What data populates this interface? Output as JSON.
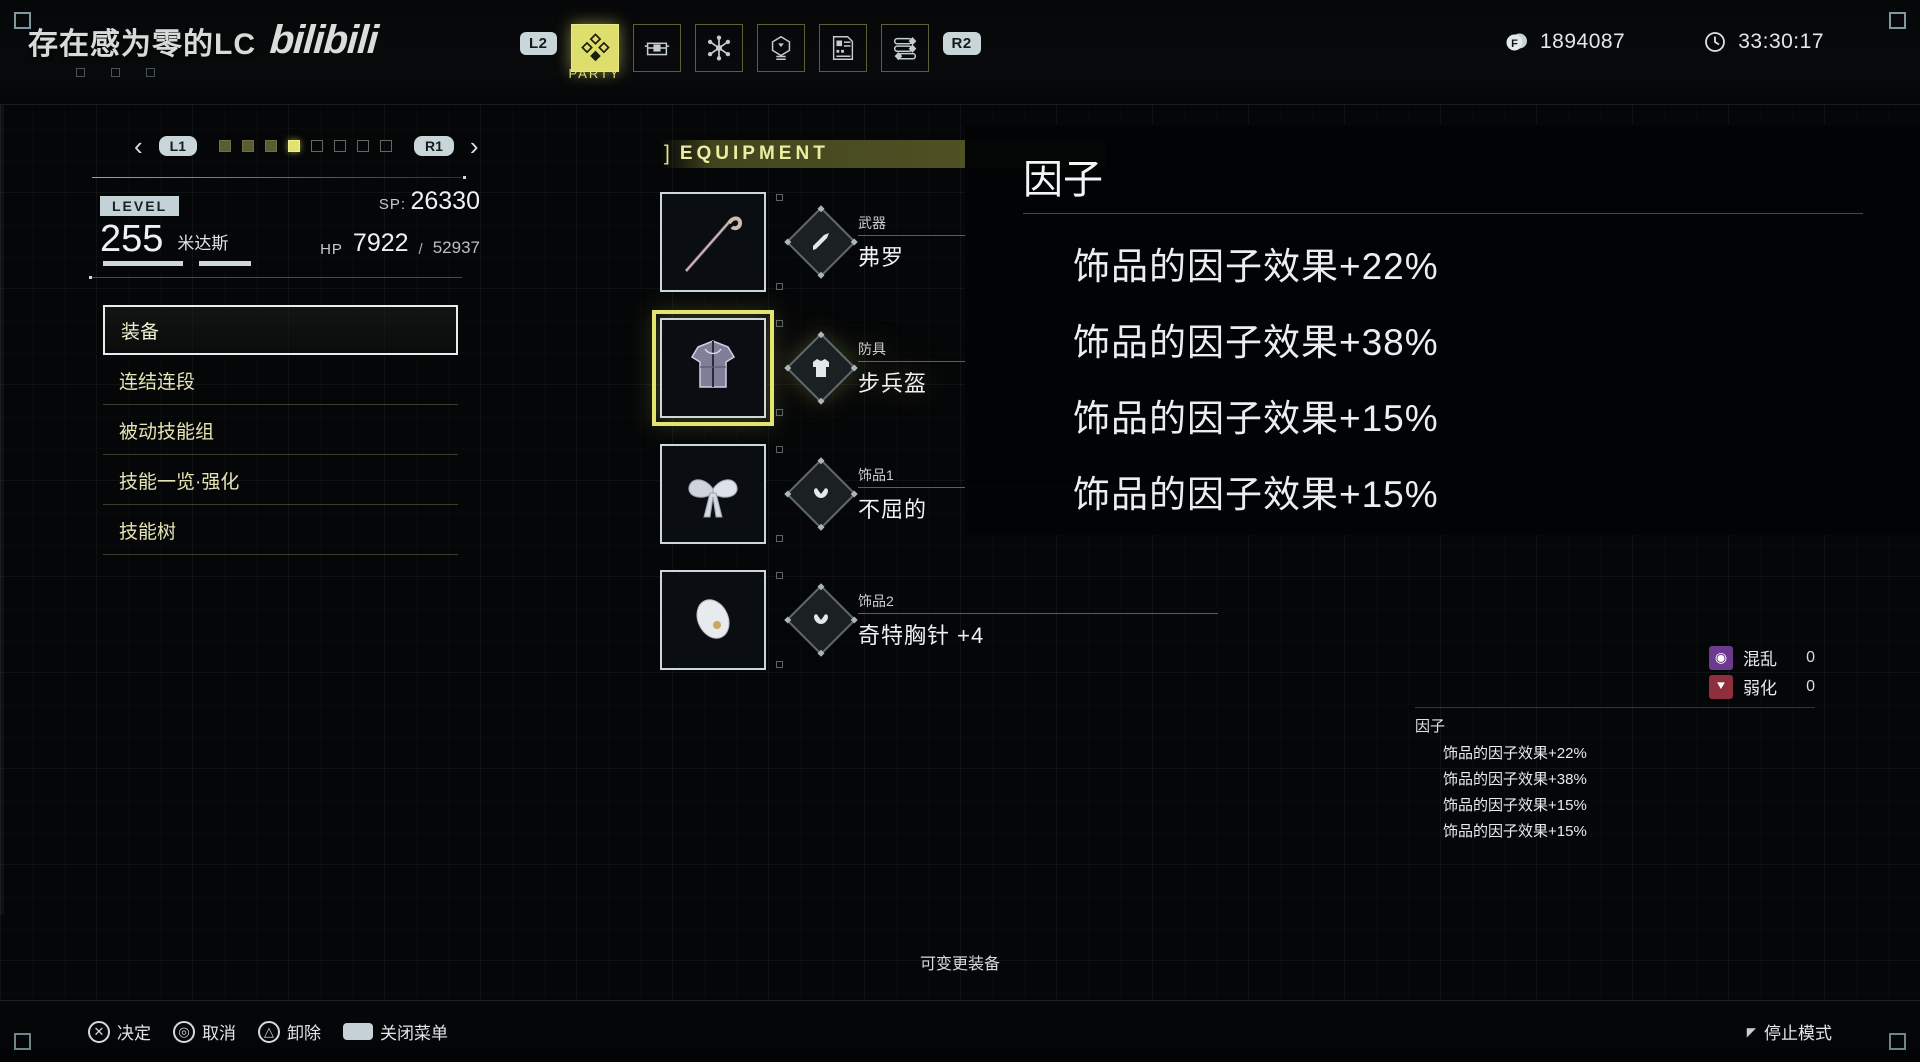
{
  "watermark": {
    "text": "存在感为零的LC",
    "logo": "bilibili"
  },
  "topbar": {
    "left_key": "L2",
    "right_key": "R2",
    "tabs": [
      {
        "id": "party",
        "label": "PARTY",
        "icon": "diamond-cluster-icon",
        "active": true
      },
      {
        "id": "items",
        "label": "",
        "icon": "chest-icon",
        "active": false
      },
      {
        "id": "skills",
        "label": "",
        "icon": "snowflake-node-icon",
        "active": false
      },
      {
        "id": "knowledge",
        "label": "",
        "icon": "bulb-hex-icon",
        "active": false
      },
      {
        "id": "records",
        "label": "",
        "icon": "document-icon",
        "active": false
      },
      {
        "id": "settings",
        "label": "",
        "icon": "sliders-icon",
        "active": false
      }
    ],
    "currency": {
      "icon": "coin-icon",
      "value": "1894087"
    },
    "playtime": {
      "icon": "clock-icon",
      "value": "33:30:17"
    }
  },
  "character": {
    "pager": {
      "prev_arrow": "‹",
      "next_arrow": "›",
      "left_key": "L1",
      "right_key": "R1",
      "dot_count": 8,
      "current_index": 3,
      "past_count": 3
    },
    "level_label": "LEVEL",
    "level_value": "255",
    "name": "米达斯",
    "sp_label": "SP:",
    "sp_value": "26330",
    "hp_label": "HP",
    "hp_current": "7922",
    "hp_separator": "/",
    "hp_max": "52937",
    "menu": [
      {
        "label": "装备",
        "selected": true
      },
      {
        "label": "连结连段",
        "selected": false
      },
      {
        "label": "被动技能组",
        "selected": false
      },
      {
        "label": "技能一览·强化",
        "selected": false
      },
      {
        "label": "技能树",
        "selected": false
      }
    ]
  },
  "equipment": {
    "header_bracket": "]",
    "header_title": "EQUIPMENT",
    "slots": [
      {
        "kind": "武器",
        "name": "弗罗",
        "icon": "sword-icon",
        "art": "staff",
        "active": false
      },
      {
        "kind": "防具",
        "name": "步兵盔",
        "icon": "armor-icon",
        "art": "armor",
        "active": true
      },
      {
        "kind": "饰品1",
        "name": "不屈的",
        "icon": "accessory-icon",
        "art": "ribbon",
        "active": false
      },
      {
        "kind": "饰品2",
        "name": "奇特胸针 +4",
        "icon": "accessory-icon",
        "art": "brooch",
        "active": false
      }
    ],
    "footer_hint": "可变更装备"
  },
  "tooltip": {
    "status_effects": [
      {
        "icon": "aura-icon",
        "label": "混乱",
        "value": "0",
        "color": "#6d3a8f"
      },
      {
        "icon": "down-arrows-icon",
        "label": "弱化",
        "value": "0",
        "color": "#8e2f3d"
      }
    ],
    "section_title": "因子",
    "lines": [
      "饰品的因子效果+22%",
      "饰品的因子效果+38%",
      "饰品的因子效果+15%",
      "饰品的因子效果+15%"
    ]
  },
  "magnified_overlay": {
    "title": "因子",
    "lines": [
      "饰品的因子效果+22%",
      "饰品的因子效果+38%",
      "饰品的因子效果+15%",
      "饰品的因子效果+15%"
    ]
  },
  "footer": {
    "hints": [
      {
        "button": "cross-button",
        "glyph": "✕",
        "label": "决定"
      },
      {
        "button": "circle-button",
        "glyph": "◎",
        "label": "取消"
      },
      {
        "button": "triangle-button",
        "glyph": "△",
        "label": "卸除"
      },
      {
        "button": "options-button",
        "glyph": "",
        "label": "关闭菜单"
      }
    ],
    "stop_mode": "停止模式"
  },
  "colors": {
    "accent": "#ddde6c",
    "text": "#e8ecec",
    "panel": "#050607",
    "select_border": "#e9ecec"
  }
}
